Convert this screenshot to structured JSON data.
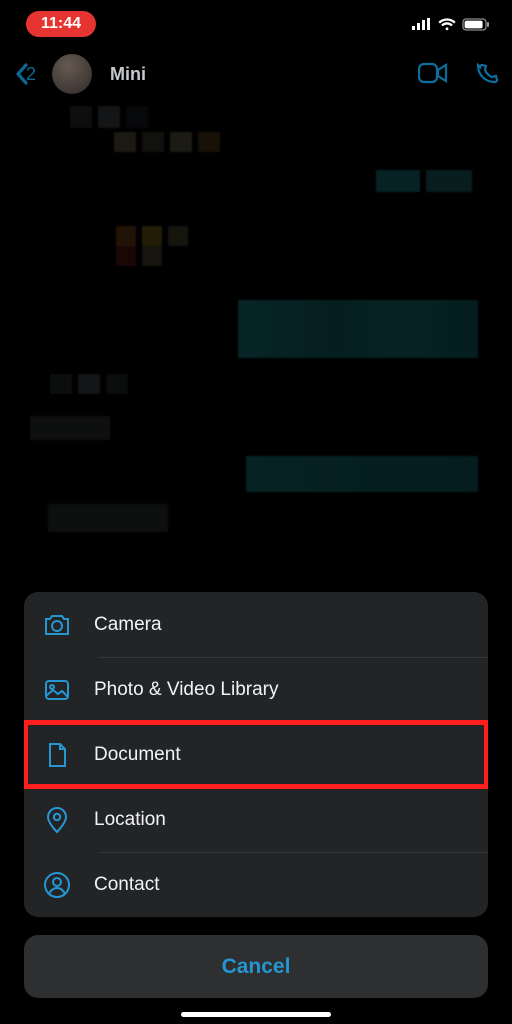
{
  "status": {
    "time": "11:44"
  },
  "nav": {
    "back_count": "2",
    "contact": "Mini"
  },
  "sheet": {
    "items": {
      "camera": "Camera",
      "library": "Photo & Video Library",
      "document": "Document",
      "location": "Location",
      "contact": "Contact"
    },
    "cancel": "Cancel"
  },
  "highlighted_item": "document"
}
